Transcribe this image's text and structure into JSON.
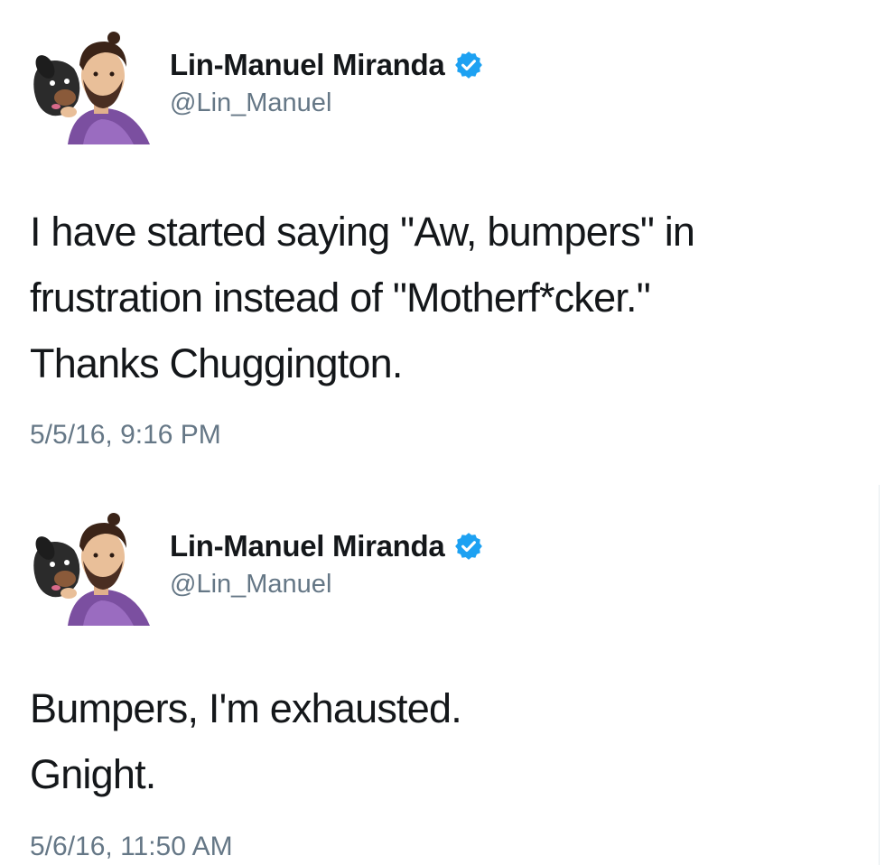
{
  "tweets": [
    {
      "display_name": "Lin-Manuel Miranda",
      "handle": "@Lin_Manuel",
      "verified_icon": "verified-badge-icon",
      "text": "I have started saying \"Aw, bumpers\" in\nfrustration instead of \"Motherf*cker.\"\nThanks Chuggington.",
      "timestamp": "5/5/16, 9:16 PM"
    },
    {
      "display_name": "Lin-Manuel Miranda",
      "handle": "@Lin_Manuel",
      "verified_icon": "verified-badge-icon",
      "text": "Bumpers, I'm exhausted.\nGnight.",
      "timestamp": "5/6/16, 11:50 AM"
    }
  ],
  "colors": {
    "text_primary": "#14171a",
    "text_secondary": "#657786",
    "verified_blue": "#1da1f2",
    "avatar_shirt": "#7b4fa0"
  }
}
